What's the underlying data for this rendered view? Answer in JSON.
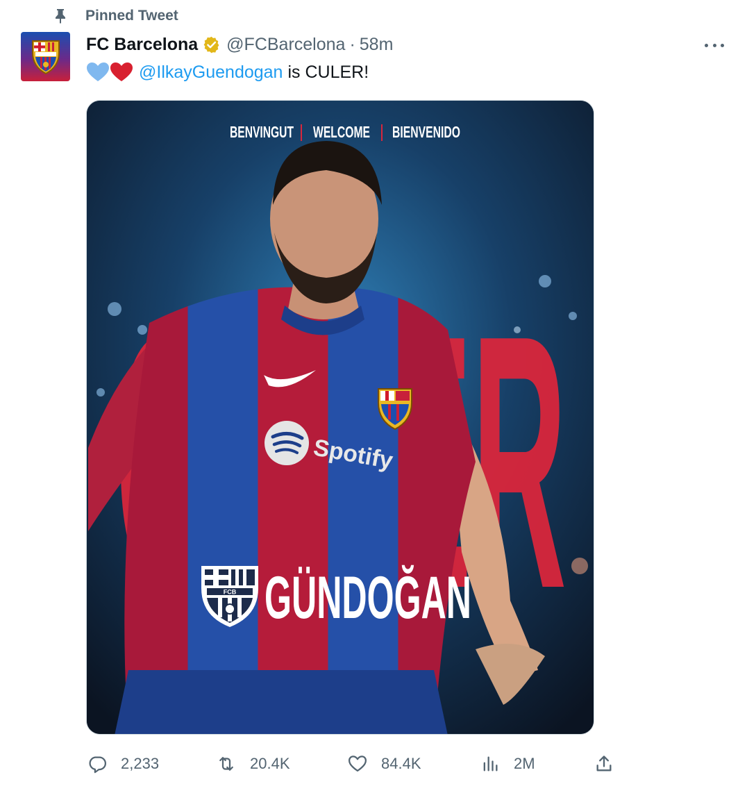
{
  "pinned": {
    "label": "Pinned Tweet",
    "icon": "pin-icon"
  },
  "author": {
    "name": "FC Barcelona",
    "handle": "@FCBarcelona",
    "separator": "·",
    "time": "58m",
    "verified_icon": "verified-badge-icon"
  },
  "tweet": {
    "mention": "@IlkayGuendogan",
    "text": "is CULER!",
    "emojis": [
      "blue-heart",
      "red-heart"
    ]
  },
  "media": {
    "banner_word_1": "BENVINGUT",
    "banner_word_2": "WELCOME",
    "banner_word_3": "BIENVENIDO",
    "big_word": "CULER",
    "player_name": "GÜNDOĞAN",
    "sponsor": "Spotify",
    "crest_text": "FCB"
  },
  "actions": {
    "replies": "2,233",
    "retweets": "20.4K",
    "likes": "84.4K",
    "views": "2M"
  },
  "colors": {
    "text": "#0f1419",
    "secondary": "#536471",
    "link": "#1d9bf0",
    "blaugrana_red": "#c8203a",
    "blaugrana_blue": "#1b4fb0",
    "verified_gold": "#e2b719"
  }
}
